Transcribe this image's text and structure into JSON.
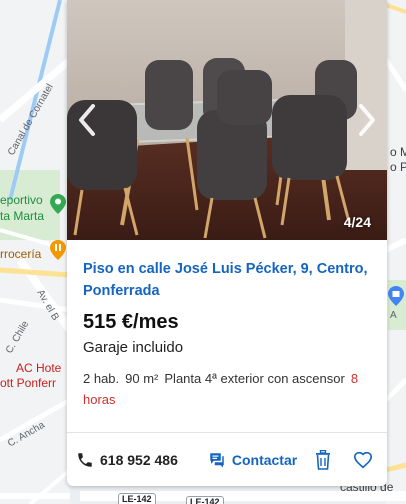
{
  "map": {
    "labels": {
      "canal_de_cornatel": "Canal de Cornatel",
      "deportivo": "eportivo",
      "santa_marta": "ta Marta",
      "errocera": "rrocería",
      "av_el_bierzo": "Av. el B",
      "c_chile": "C. Chile",
      "ac_hotel": "AC Hote",
      "ac_hotel_2": "ott Ponferr",
      "c_ancha": "C. Ancha",
      "right_top": "o M",
      "right_top_2": "o P",
      "right_mid": "A",
      "right_bottom": "castillo de",
      "road_le142_1": "LE-142",
      "road_le142_2": "LE-142"
    }
  },
  "listing": {
    "photo": {
      "counter": "4/24"
    },
    "title": "Piso en calle José Luis Pécker, 9, Centro, Ponferrada",
    "price": "515 €/mes",
    "extra": "Garaje incluido",
    "details": {
      "rooms": "2 hab.",
      "area": "90 m²",
      "floor": "Planta 4ª exterior con ascensor",
      "age": "8 horas"
    },
    "actions": {
      "phone": "618 952 486",
      "contact": "Contactar"
    }
  },
  "icons": {
    "prev": "chevron-left-icon",
    "next": "chevron-right-icon",
    "phone": "phone-icon",
    "contact": "chat-icon",
    "trash": "trash-icon",
    "favorite": "heart-icon"
  },
  "colors": {
    "link": "#1565c0",
    "age": "#d32f2f"
  }
}
